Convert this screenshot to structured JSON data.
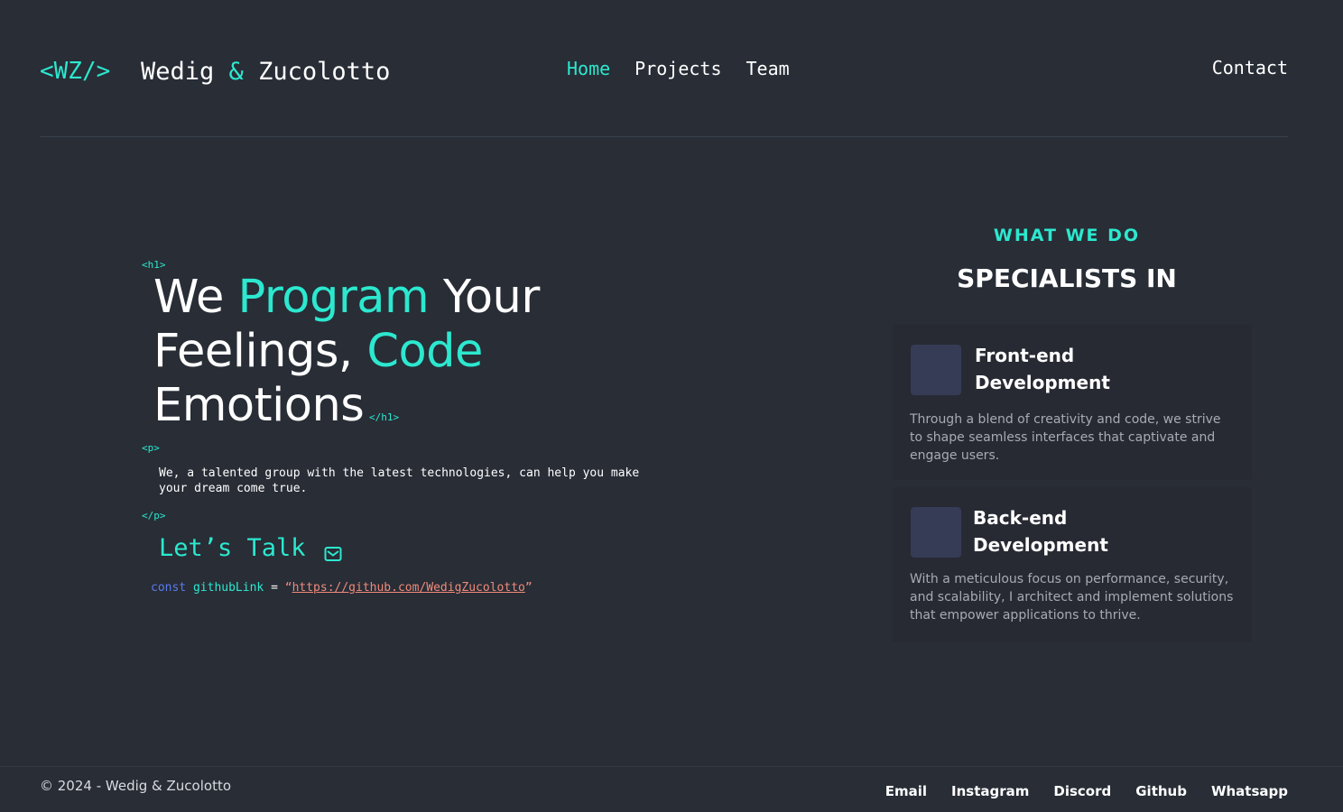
{
  "header": {
    "logo": "<WZ/>",
    "brand_first": "Wedig",
    "brand_amp": "&",
    "brand_last": "Zucolotto",
    "nav": [
      {
        "label": "Home",
        "active": true
      },
      {
        "label": "Projects",
        "active": false
      },
      {
        "label": "Team",
        "active": false
      }
    ],
    "contact": "Contact"
  },
  "hero": {
    "tag_h1_open": "<h1>",
    "tag_h1_close": "</h1>",
    "tag_p_open": "<p>",
    "tag_p_close": "</p>",
    "heading": {
      "w1": "We",
      "w2": "Program",
      "w3": "Your",
      "w4": "Feelings,",
      "w5": "Code",
      "w6": "Emotions"
    },
    "paragraph": "We, a talented group with the latest technologies, can help you make your dream come true.",
    "cta_label": "Let’s Talk",
    "cta_icon": "mail-icon",
    "code": {
      "keyword": "const",
      "variable": "githubLink",
      "operator": "=",
      "quote_open": "“",
      "link": "https://github.com/WedigZucolotto",
      "quote_close": "”"
    }
  },
  "services": {
    "eyebrow": "WHAT WE DO",
    "title": "SPECIALISTS IN",
    "cards": [
      {
        "title_line1": "Front-end",
        "title_line2": "Development",
        "description": "Through a blend of creativity and code, we strive to shape seamless interfaces that captivate and engage users."
      },
      {
        "title_line1": "Back-end",
        "title_line2": "Development",
        "description": "With a meticulous focus on performance, security, and scalability, I architect and implement solutions that empower applications to thrive."
      }
    ]
  },
  "footer": {
    "copyright": "© 2024 - Wedig & Zucolotto",
    "links": [
      "Email",
      "Instagram",
      "Discord",
      "Github",
      "Whatsapp"
    ]
  },
  "colors": {
    "background": "#282d36",
    "accent": "#2ce8cf",
    "card": "#272a33",
    "thumb": "#363c56",
    "code_keyword": "#5a7bf0",
    "code_string": "#f08a7a"
  }
}
